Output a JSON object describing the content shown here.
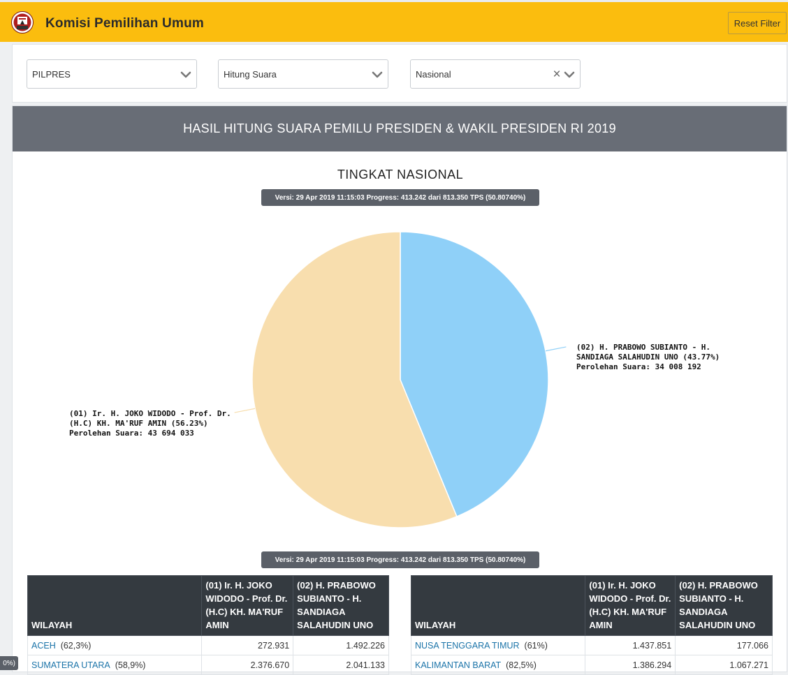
{
  "header": {
    "app_title": "Komisi Pemilihan Umum",
    "reset_label": "Reset Filter"
  },
  "filters": {
    "election": "PILPRES",
    "mode": "Hitung Suara",
    "region": "Nasional"
  },
  "panel": {
    "title": "HASIL HITUNG SUARA PEMILU PRESIDEN & WAKIL PRESIDEN RI 2019",
    "subtitle": "TINGKAT NASIONAL",
    "version_text": "Versi: 29 Apr 2019 11:15:03 Progress: 413.242 dari 813.350 TPS (50.80740%)"
  },
  "chart_data": {
    "type": "pie",
    "slices": [
      {
        "name_line1": "(01) Ir. H. JOKO WIDODO - Prof. Dr.",
        "name_line2": "(H.C) KH. MA'RUF AMIN (56.23%)",
        "votes_line": "Perolehan Suara: 43 694 033",
        "percent": 56.23,
        "votes": 43694033,
        "color": "#f8deae"
      },
      {
        "name_line1": "(02) H. PRABOWO SUBIANTO - H.",
        "name_line2": "SANDIAGA SALAHUDIN UNO (43.77%)",
        "votes_line": "Perolehan Suara: 34 008 192",
        "percent": 43.77,
        "votes": 34008192,
        "color": "#8fd0f8"
      }
    ]
  },
  "table_headers": {
    "region": "WILAYAH",
    "c01": "(01) Ir. H. JOKO WIDODO - Prof. Dr. (H.C) KH. MA'RUF AMIN",
    "c02": "(02) H. PRABOWO SUBIANTO - H. SANDIAGA SALAHUDIN UNO"
  },
  "table_left": [
    {
      "region": "ACEH",
      "pct": "(62,3%)",
      "c01": "272.931",
      "c02": "1.492.226"
    },
    {
      "region": "SUMATERA UTARA",
      "pct": "(58,9%)",
      "c01": "2.376.670",
      "c02": "2.041.133"
    }
  ],
  "table_right": [
    {
      "region": "NUSA TENGGARA TIMUR",
      "pct": "(61%)",
      "c01": "1.437.851",
      "c02": "177.066"
    },
    {
      "region": "KALIMANTAN BARAT",
      "pct": "(82,5%)",
      "c01": "1.386.294",
      "c02": "1.067.271"
    }
  ],
  "edge_badge": "0%)"
}
